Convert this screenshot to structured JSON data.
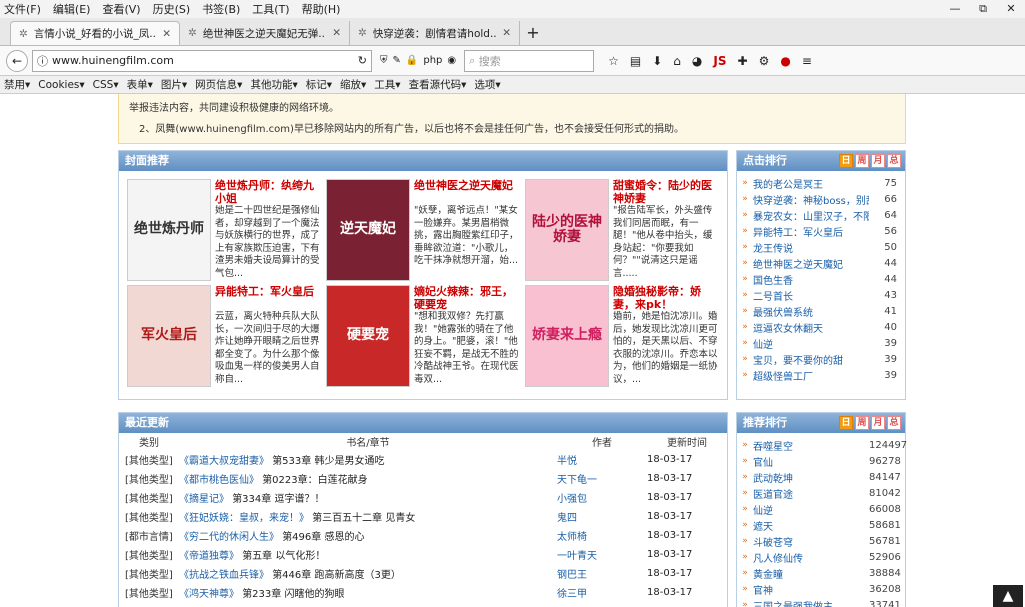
{
  "menu": [
    "文件(F)",
    "编辑(E)",
    "查看(V)",
    "历史(S)",
    "书签(B)",
    "工具(T)",
    "帮助(H)"
  ],
  "window_controls": [
    "—",
    "⧉",
    "✕"
  ],
  "tabs": [
    {
      "label": "言情小说_好看的小说_凤...",
      "icon": "gear-icon"
    },
    {
      "label": "绝世神医之逆天魔妃无弹...",
      "icon": "gear-icon"
    },
    {
      "label": "快穿逆袭：剧情君请hold...",
      "icon": "gear-icon"
    }
  ],
  "new_tab": "+",
  "url": "www.huinengfilm.com",
  "url_icons": [
    "shield-icon",
    "paint-icon",
    "lock-icon",
    "php",
    "camera-icon",
    "tag-icon",
    "clipboard-icon",
    "feather-icon"
  ],
  "search_placeholder": "搜索",
  "bookmarks": [
    "禁用▾",
    "Cookies▾",
    "CSS▾",
    "表单▾",
    "图片▾",
    "网页信息▾",
    "其他功能▾",
    "标记▾",
    "缩放▾",
    "工具▾",
    "查看源代码▾",
    "选项▾"
  ],
  "notice": {
    "line1": "举报违法内容，共同建设积极健康的网络环境。",
    "line2": "2、凤舞(www.huinengfilm.com)早已移除网站内的所有广告，以后也将不会是挂任何广告，也不会接受任何形式的捐助。"
  },
  "featured": {
    "title": "封面推荐",
    "books": [
      {
        "title": "绝世炼丹师：纨绔九小姐",
        "desc": "她是二十四世纪是强修仙者，却穿越到了一个魔法与妖族横行的世界，成了上有家族欺压迫害，下有渣男未婚夫设局算计的受气包...",
        "cover_text": "绝世炼丹师",
        "color": "#f4f4f4",
        "fg": "#333"
      },
      {
        "title": "绝世神医之逆天魔妃",
        "desc": "\"妖孽，离爷远点！\"某女一脸嫌弃。某男眉梢微挑，露出胸膛紫红印子，垂眸欲泣道：\"小歌儿，吃干抹净就想开溜，始...",
        "cover_text": "逆天魔妃",
        "color": "#7a2233",
        "fg": "#fff"
      },
      {
        "title": "甜蜜婚令：陆少的医神娇妻",
        "desc": "\"报告陆军长，外头盛传我们同居而眠，有一腿！\"他从卷中抬头，缓身站起：\"你要我如何？\"\"说清这只是谣言.....",
        "cover_text": "陆少的医神娇妻",
        "color": "#f6c7d3",
        "fg": "#b0103a"
      },
      {
        "title": "异能特工：军火皇后",
        "desc": "云蓝，离火特种兵队大队长，一次间归于尽的大爆炸让她睁开眼睛之后世界都全变了。为什么那个像吸血鬼一样的俊美男人自称自...",
        "cover_text": "军火皇后",
        "color": "#f2d8d2",
        "fg": "#b01818"
      },
      {
        "title": "嫡妃火辣辣：邪王，硬要宠",
        "desc": "\"想和我双修？先打赢我！\"她露张的骑在了他的身上。\"肥婆，滚！\"他狂妄不羁，是战无不胜的冷酷战神王爷。在现代医毒双...",
        "cover_text": "硬要宠",
        "color": "#c82828",
        "fg": "#fff"
      },
      {
        "title": "隐婚独秘影帝：娇妻，来pk！",
        "desc": "婚前，她是怕沈凉川。婚后，她发现比沈凉川更可怕的，是天黑以后、不穿衣服的沈凉川。乔恋本以为，他们的婚姻是一纸协议，...",
        "cover_text": "娇妻来上瘾",
        "color": "#f8c0d0",
        "fg": "#d02060"
      }
    ]
  },
  "hot_rank": {
    "title": "点击排行",
    "tabs": [
      "日",
      "周",
      "月",
      "总"
    ],
    "items": [
      {
        "name": "我的老公是冥王",
        "count": "75"
      },
      {
        "name": "快穿逆袭：神秘boss，别乱",
        "count": "66"
      },
      {
        "name": "暴宠农女：山里汉子，不限",
        "count": "64"
      },
      {
        "name": "异能特工：军火皇后",
        "count": "56"
      },
      {
        "name": "龙王传说",
        "count": "50"
      },
      {
        "name": "绝世神医之逆天魔妃",
        "count": "44"
      },
      {
        "name": "国色生香",
        "count": "44"
      },
      {
        "name": "二号首长",
        "count": "43"
      },
      {
        "name": "最强伏兽系统",
        "count": "41"
      },
      {
        "name": "逗逼农女休翻天",
        "count": "40"
      },
      {
        "name": "仙逆",
        "count": "39"
      },
      {
        "name": "宝贝，要不要你的甜",
        "count": "39"
      },
      {
        "name": "超级怪兽工厂",
        "count": "39"
      }
    ]
  },
  "rec_rank": {
    "title": "推荐排行",
    "tabs": [
      "日",
      "周",
      "月",
      "总"
    ],
    "items": [
      {
        "name": "吞噬星空",
        "count": "124497"
      },
      {
        "name": "官仙",
        "count": "96278"
      },
      {
        "name": "武动乾坤",
        "count": "84147"
      },
      {
        "name": "医道官途",
        "count": "81042"
      },
      {
        "name": "仙逆",
        "count": "66008"
      },
      {
        "name": "遮天",
        "count": "58681"
      },
      {
        "name": "斗破苍穹",
        "count": "56781"
      },
      {
        "name": "凡人修仙传",
        "count": "52906"
      },
      {
        "name": "黄金瞳",
        "count": "38884"
      },
      {
        "name": "官神",
        "count": "36208"
      },
      {
        "name": "三国之最强我做主",
        "count": "33741"
      }
    ]
  },
  "recent": {
    "title": "最近更新",
    "headers": [
      "类别",
      "书名/章节",
      "作者",
      "更新时间"
    ],
    "rows": [
      {
        "cat": "[其他类型]",
        "book": "《霸道大叔宠甜妻》",
        "chapter": "第533章 韩少是男女通吃",
        "author": "半悦",
        "date": "18-03-17"
      },
      {
        "cat": "[其他类型]",
        "book": "《都市桃色医仙》",
        "chapter": "第0223章：白莲花献身",
        "author": "天下龟一",
        "date": "18-03-17"
      },
      {
        "cat": "[其他类型]",
        "book": "《摘星记》",
        "chapter": "第334章 逗字谱？！",
        "author": "小强包",
        "date": "18-03-17"
      },
      {
        "cat": "[其他类型]",
        "book": "《狂妃妖娆：皇叔，来宠！》",
        "chapter": "第三百五十二章 见青女",
        "author": "鬼四",
        "date": "18-03-17"
      },
      {
        "cat": "[都市言情]",
        "book": "《穷二代的休闲人生》",
        "chapter": "第496章 感恩的心",
        "author": "太师椅",
        "date": "18-03-17"
      },
      {
        "cat": "[其他类型]",
        "book": "《帝道独尊》",
        "chapter": "第五章 以气化形！",
        "author": "一叶青天",
        "date": "18-03-17"
      },
      {
        "cat": "[其他类型]",
        "book": "《抗战之铁血兵锋》",
        "chapter": "第446章 跑高新高度（3更）",
        "author": "钢巴王",
        "date": "18-03-17"
      },
      {
        "cat": "[其他类型]",
        "book": "《鸿天神尊》",
        "chapter": "第233章 闪瞎他的狗眼",
        "author": "徐三甲",
        "date": "18-03-17"
      }
    ]
  },
  "scroll_top": "▲"
}
